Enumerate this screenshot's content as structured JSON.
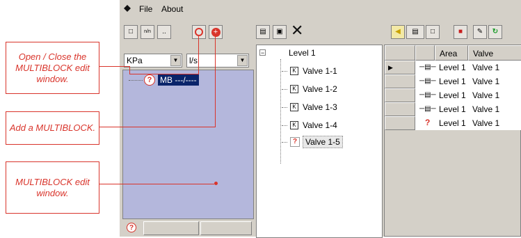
{
  "callouts": [
    {
      "text": "Open / Close the MULTIBLOCK edit window."
    },
    {
      "text": "Add a MULTIBLOCK."
    },
    {
      "text": "MULTIBLOCK edit window."
    }
  ],
  "menu": {
    "items": [
      "File",
      "About"
    ]
  },
  "toolbar_left": {
    "buttons": [
      "pin",
      "n/n",
      "..",
      "open-close-multiblock",
      "add-multiblock"
    ]
  },
  "units": {
    "pressure": "KPa",
    "flow": "l/s"
  },
  "multiblock": {
    "label": "MB ---/----"
  },
  "tree": {
    "root": "Level 1",
    "items": [
      "Valve 1-1",
      "Valve 1-2",
      "Valve 1-3",
      "Valve 1-4",
      "Valve 1-5"
    ]
  },
  "grid": {
    "headers": [
      "Area",
      "Valve"
    ],
    "rows": [
      {
        "area": "Level 1",
        "valve": "Valve 1"
      },
      {
        "area": "Level 1",
        "valve": "Valve 1"
      },
      {
        "area": "Level 1",
        "valve": "Valve 1"
      },
      {
        "area": "Level 1",
        "valve": "Valve 1"
      },
      {
        "area": "Level 1",
        "valve": "Valve 1"
      }
    ]
  },
  "colors": {
    "accent_red": "#d9342b",
    "edit_window_bg": "#b4b7dc",
    "chrome": "#d4d0c8"
  }
}
